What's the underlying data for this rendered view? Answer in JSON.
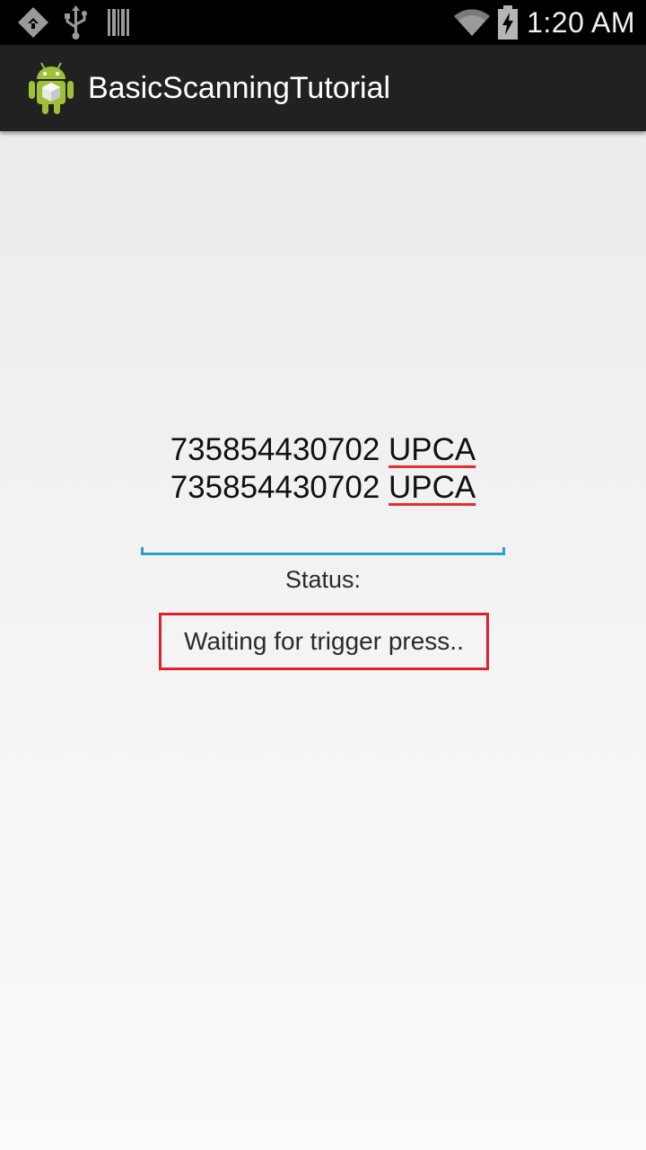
{
  "status_bar": {
    "time": "1:20 AM",
    "left_icons": [
      "diamond-notification-icon",
      "usb-icon",
      "barcode-icon"
    ],
    "right_icons": [
      "wifi-icon",
      "battery-charging-icon"
    ]
  },
  "action_bar": {
    "title": "BasicScanningTutorial",
    "icon": "android-app-icon"
  },
  "main": {
    "scan_results": [
      {
        "code": "735854430702",
        "type": "UPCA"
      },
      {
        "code": "735854430702",
        "type": "UPCA"
      }
    ],
    "status_label": "Status:",
    "status_value": "Waiting for trigger press.."
  },
  "colors": {
    "accent_underline": "#2b9fd0",
    "highlight_border": "#e0202a",
    "spellcheck_underline": "#e03030"
  }
}
